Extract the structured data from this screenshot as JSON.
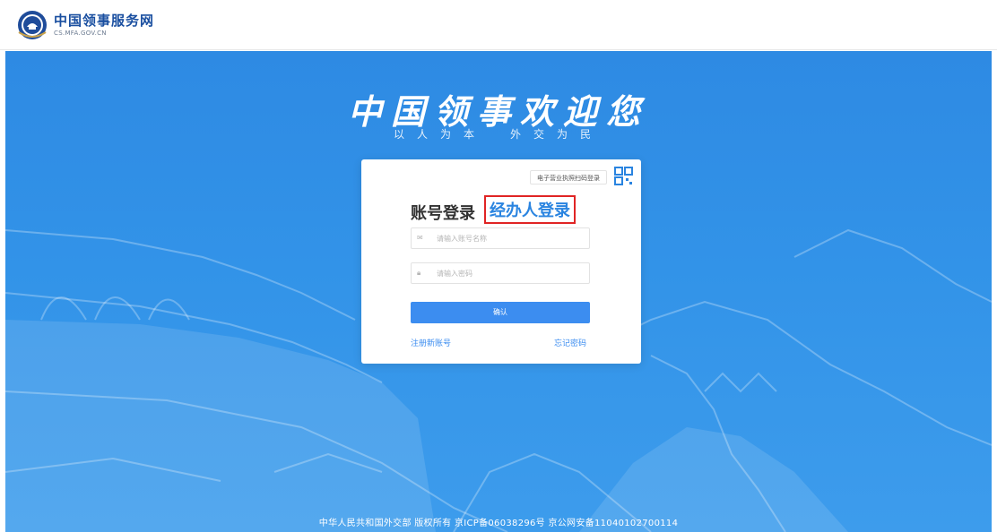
{
  "header": {
    "logo_title": "中国领事服务网",
    "logo_subtitle": "CS.MFA.GOV.CN"
  },
  "hero": {
    "welcome": "中国领事欢迎您",
    "slogan_left": "以人为本",
    "slogan_right": "外交为民"
  },
  "login_card": {
    "qr_tip": "电子营业执照扫码登录",
    "tab_account": "账号登录",
    "tab_agent": "经办人登录",
    "account_placeholder": "请输入账号名称",
    "password_placeholder": "请输入密码",
    "confirm_label": "确认",
    "register_link": "注册新账号",
    "forgot_link": "忘记密码"
  },
  "footer": {
    "text": "中华人民共和国外交部 版权所有 京ICP备06038296号 京公网安备11040102700114"
  },
  "colors": {
    "hero_blue": "#2e8ae3",
    "accent": "#3c8df0",
    "highlight_border": "#e02424"
  }
}
